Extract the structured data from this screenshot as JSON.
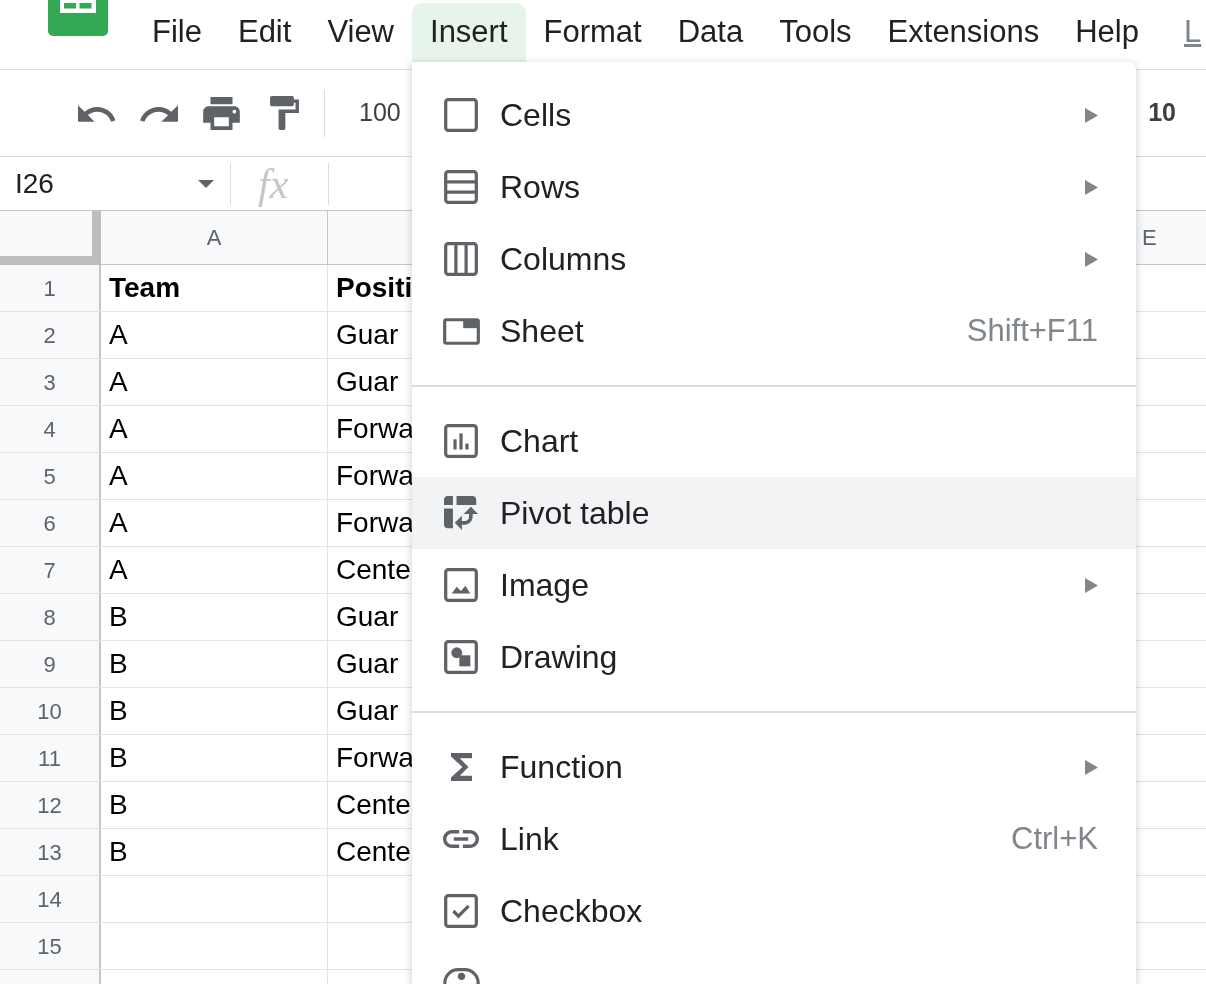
{
  "menu_bar": {
    "items": [
      {
        "label": "File",
        "selected": false
      },
      {
        "label": "Edit",
        "selected": false
      },
      {
        "label": "View",
        "selected": false
      },
      {
        "label": "Insert",
        "selected": true
      },
      {
        "label": "Format",
        "selected": false
      },
      {
        "label": "Data",
        "selected": false
      },
      {
        "label": "Tools",
        "selected": false
      },
      {
        "label": "Extensions",
        "selected": false
      },
      {
        "label": "Help",
        "selected": false
      }
    ],
    "last_edit": "L"
  },
  "toolbar": {
    "zoom": "100",
    "font_size": "10"
  },
  "formula_bar": {
    "cell_reference": "I26",
    "function_label": "fx"
  },
  "sheet": {
    "column_headers": [
      "A",
      "E"
    ],
    "rows": [
      {
        "number": "1",
        "cells": [
          "Team",
          "Positi"
        ]
      },
      {
        "number": "2",
        "cells": [
          "A",
          "Guar"
        ]
      },
      {
        "number": "3",
        "cells": [
          "A",
          "Guar"
        ]
      },
      {
        "number": "4",
        "cells": [
          "A",
          "Forwa"
        ]
      },
      {
        "number": "5",
        "cells": [
          "A",
          "Forwa"
        ]
      },
      {
        "number": "6",
        "cells": [
          "A",
          "Forwa"
        ]
      },
      {
        "number": "7",
        "cells": [
          "A",
          "Cente"
        ]
      },
      {
        "number": "8",
        "cells": [
          "B",
          "Guar"
        ]
      },
      {
        "number": "9",
        "cells": [
          "B",
          "Guar"
        ]
      },
      {
        "number": "10",
        "cells": [
          "B",
          "Guar"
        ]
      },
      {
        "number": "11",
        "cells": [
          "B",
          "Forwa"
        ]
      },
      {
        "number": "12",
        "cells": [
          "B",
          "Cente"
        ]
      },
      {
        "number": "13",
        "cells": [
          "B",
          "Cente"
        ]
      },
      {
        "number": "14"
      },
      {
        "number": "15"
      }
    ]
  },
  "insert_menu": {
    "sections": [
      {
        "items": [
          {
            "label": "Cells",
            "submenu": true,
            "selected": false
          },
          {
            "label": "Rows",
            "submenu": true,
            "selected": false
          },
          {
            "label": "Columns",
            "submenu": true,
            "selected": false
          },
          {
            "label": "Sheet",
            "shortcut": "Shift+F11",
            "submenu": false,
            "selected": false
          }
        ]
      },
      {
        "items": [
          {
            "label": "Chart",
            "submenu": false,
            "selected": false
          },
          {
            "label": "Pivot table",
            "submenu": false,
            "selected": true
          },
          {
            "label": "Image",
            "submenu": true,
            "selected": false
          },
          {
            "label": "Drawing",
            "submenu": false,
            "selected": false
          }
        ]
      },
      {
        "items": [
          {
            "label": "Function",
            "submenu": true,
            "selected": false
          },
          {
            "label": "Link",
            "shortcut": "Ctrl+K",
            "submenu": false,
            "selected": false
          },
          {
            "label": "Checkbox",
            "submenu": false,
            "selected": false
          },
          {
            "selected": false
          }
        ]
      }
    ]
  }
}
